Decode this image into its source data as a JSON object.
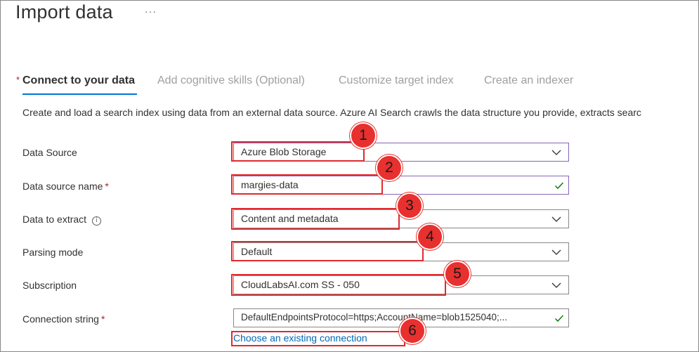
{
  "page": {
    "title": "Import data",
    "more_icon": "···"
  },
  "tabs": [
    {
      "label": "Connect to your data",
      "active": true,
      "required_star": "*"
    },
    {
      "label": "Add cognitive skills (Optional)",
      "active": false
    },
    {
      "label": "Customize target index",
      "active": false
    },
    {
      "label": "Create an indexer",
      "active": false
    }
  ],
  "description": "Create and load a search index using data from an external data source. Azure AI Search crawls the data structure you provide, extracts searc",
  "form": {
    "data_source": {
      "label": "Data Source",
      "value": "Azure Blob Storage"
    },
    "data_source_name": {
      "label": "Data source name",
      "required": "*",
      "value": "margies-data"
    },
    "data_to_extract": {
      "label": "Data to extract",
      "info_icon": "i",
      "value": "Content and metadata"
    },
    "parsing_mode": {
      "label": "Parsing mode",
      "value": "Default"
    },
    "subscription": {
      "label": "Subscription",
      "value": "CloudLabsAI.com SS - 050"
    },
    "connection_string": {
      "label": "Connection string",
      "required": "*",
      "value": "DefaultEndpointsProtocol=https;AccountName=blob1525040;..."
    },
    "choose_connection_link": "Choose an existing connection"
  },
  "callouts": [
    "1",
    "2",
    "3",
    "4",
    "5",
    "6"
  ],
  "colors": {
    "accent": "#0078d4",
    "callout": "#e8302f",
    "required": "#a4262c",
    "valid_check": "#107c10",
    "focused_border": "#8764b8"
  }
}
